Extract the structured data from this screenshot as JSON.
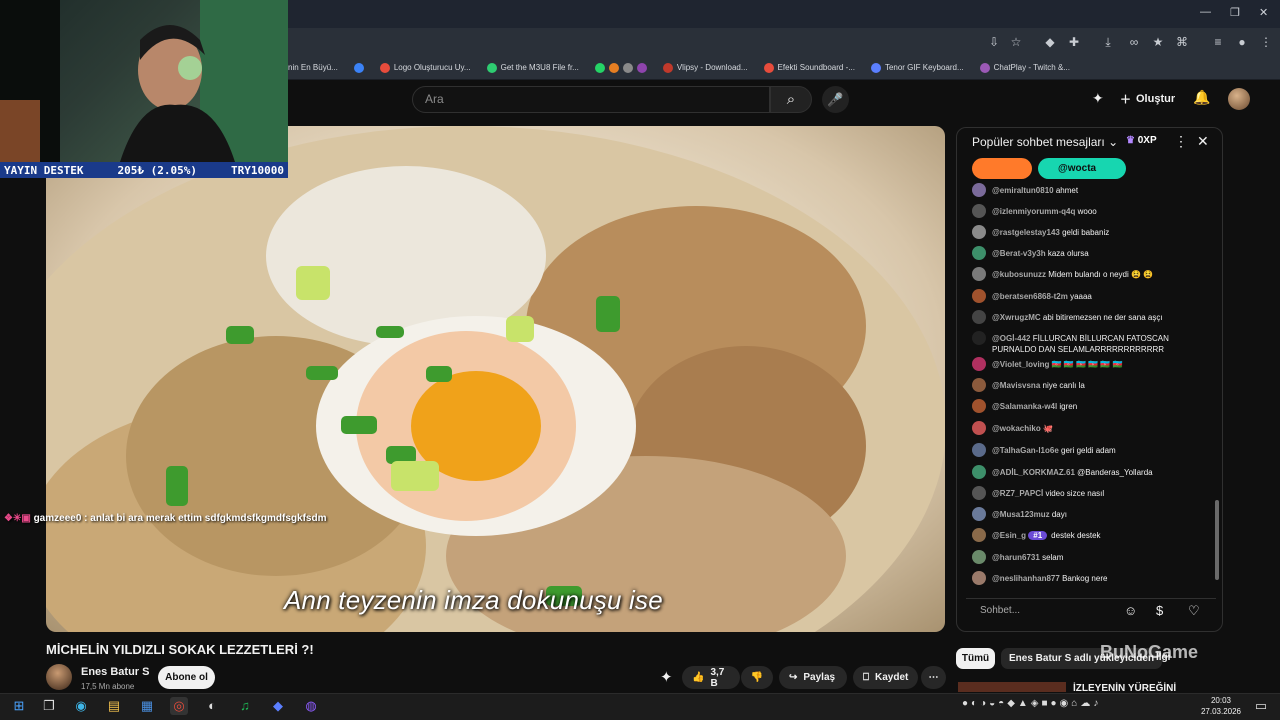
{
  "browser": {
    "bookmarks": [
      "nin En Büyü...",
      "Logo Oluşturucu Uy...",
      "Get the M3U8 File fr...",
      "Vlipsy - Download...",
      "Efekti Soundboard -...",
      "Tenor GIF Keyboard...",
      "ChatPlay - Twitch &..."
    ]
  },
  "header": {
    "search_placeholder": "Ara",
    "create_label": "Oluştur"
  },
  "stream_overlay": {
    "donation_label": "YAYIN DESTEK",
    "donation_amount": "205₺ (2.05%)",
    "donation_goal": "TRY10000",
    "on_video_chat_user": "gamzeee0 :",
    "on_video_chat_text": "anlat bi ara merak ettim sdfgkmdsfkgmdfsgkfsdm"
  },
  "video": {
    "subtitle": "Ann teyzenin imza dokunuşu ise",
    "title": "MİCHELİN YILDIZLI SOKAK LEZZETLERİ ?!",
    "channel_name": "Enes Batur S",
    "channel_subs": "17,5 Mn abone",
    "subscribe_label": "Abone ol",
    "like_count": "3,7 B",
    "share_label": "Paylaş",
    "save_label": "Kaydet"
  },
  "chat": {
    "header": "Popüler sohbet mesajları",
    "xp_label": "0XP",
    "pinned_user": "@wocta",
    "input_placeholder": "Sohbet...",
    "messages": [
      {
        "author": "@emiraltun0810",
        "text": "ahmet",
        "color": "#7a6a9a"
      },
      {
        "author": "@izlenmiyorumm-q4q",
        "text": "wooo",
        "color": "#555"
      },
      {
        "author": "@rastgelestay143",
        "text": "geldi babaniz",
        "color": "#8a8a8a"
      },
      {
        "author": "@Berat-v3y3h",
        "text": "kaza olursa",
        "color": "#3d8f6a"
      },
      {
        "author": "@kubosunuzz",
        "text": "Midem bulandı o neydi 😫 😫",
        "color": "#7a7a7a"
      },
      {
        "author": "@beratsen6868-t2m",
        "text": "yaaaa",
        "color": "#a0522d"
      },
      {
        "author": "@XwrugzMC",
        "text": "abi bitiremezsen ne der sana aşçı",
        "color": "#444"
      },
      {
        "author": "@OGİ-442",
        "text": "FİLLURCAN BİLLURCAN FATOSCAN PURNALDO DAN SELAMLARRRRRRRRRRRR",
        "color": "#222"
      },
      {
        "author": "@Violet_loving",
        "text": "🇦🇿 🇦🇿 🇦🇿 🇦🇿 🇦🇿 🇦🇿",
        "color": "#b03060"
      },
      {
        "author": "@Mavisvsna",
        "text": "niye canlı la",
        "color": "#8b5a3c"
      },
      {
        "author": "@Salamanka-w4l",
        "text": "igren",
        "color": "#a0522d"
      },
      {
        "author": "@wokachiko",
        "text": "🐙",
        "color": "#c05050"
      },
      {
        "author": "@TalhaGan-l1o6e",
        "text": "geri geldi adam",
        "color": "#5a6a8a"
      },
      {
        "author": "@ADİL_KORKMAZ.61",
        "text": "@Banderas_Yollarda",
        "color": "#3d8f6a"
      },
      {
        "author": "@RZ7_PAPCİ",
        "text": "video sizce nasıl",
        "color": "#555"
      },
      {
        "author": "@Musa123muz",
        "text": "dayı",
        "color": "#6a7a9a"
      },
      {
        "author": "@Esin_g",
        "badge": "#1",
        "text": "destek destek",
        "color": "#8a6a4a"
      },
      {
        "author": "@harun6731",
        "text": "selam",
        "color": "#6a8a6a"
      },
      {
        "author": "@neslihanhan877",
        "text": "Bankog nere",
        "color": "#9a7a6a"
      }
    ]
  },
  "recommendations": {
    "chip_all": "Tümü",
    "chip_uploads": "Enes Batur S adlı yükleyiciden",
    "chip_more": "İlgi",
    "first_title": "İZLEYENİN YÜREĞİNİ"
  },
  "watermark": "BuNoGame",
  "taskbar": {
    "time": "20:03",
    "date": "27.03.2026"
  },
  "colors": {
    "bg": "#0f0f0f",
    "donate_bar": "#1a3a8a",
    "pin_orange": "#ff7a2a",
    "pin_teal": "#17d6b0"
  }
}
